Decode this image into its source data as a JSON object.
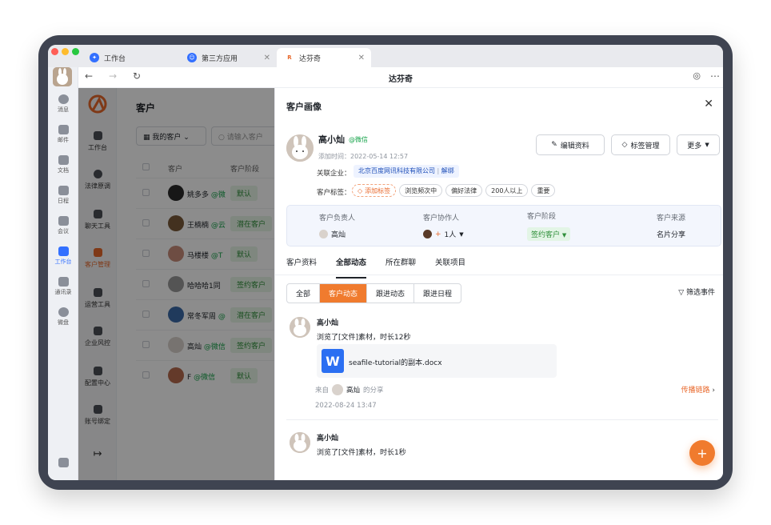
{
  "tabs": [
    {
      "label": "工作台",
      "color": "#3370ff"
    },
    {
      "label": "第三方应用",
      "color": "#3370ff"
    },
    {
      "label": "达芬奇",
      "color": "#e8682b"
    }
  ],
  "navbar": {
    "title": "达芬奇"
  },
  "rail": {
    "items": [
      "消息",
      "邮件",
      "文档",
      "日程",
      "会议",
      "工作台",
      "通讯录",
      "微盘"
    ]
  },
  "appnav": {
    "items": [
      "工作台",
      "法律原调",
      "聊天工具",
      "客户管理",
      "运营工具",
      "企业风控",
      "配置中心",
      "账号绑定"
    ]
  },
  "list": {
    "title": "客户",
    "filter": "我的客户",
    "search_placeholder": "请输入客户",
    "col_customer": "客户",
    "col_stage": "客户阶段",
    "rows": [
      {
        "name": "姚多多",
        "wx": "@微",
        "stage": "默认",
        "color": "#2b2b2b"
      },
      {
        "name": "王楠楠",
        "wx": "@云",
        "stage": "潜在客户",
        "color": "#7a5a3a"
      },
      {
        "name": "马楼楼",
        "wx": "@T",
        "stage": "默认",
        "color": "#c98c7a"
      },
      {
        "name": "哈哈哈1同",
        "wx": "",
        "stage": "签约客户",
        "color": "#9a9a9a"
      },
      {
        "name": "常冬军周",
        "wx": "@",
        "stage": "潜在客户",
        "color": "#3b6aa8"
      },
      {
        "name": "高灿",
        "wx": "@微信",
        "stage": "签约客户",
        "color": "#d9d2cc"
      },
      {
        "name": "F",
        "wx": "@微信",
        "stage": "默认",
        "color": "#b76a4d"
      }
    ]
  },
  "drawer": {
    "title": "客户画像",
    "name": "高小灿",
    "wx_tag": "@微信",
    "added_time": "添加时间：2022-05-14 12:57",
    "edit_button": "编辑资料",
    "tag_manage_button": "标签管理",
    "more_button": "更多",
    "company_label": "关联企业：",
    "company_name": "北京百度网讯科技有限公司",
    "unbind": "解绑",
    "tags_label": "客户标签：",
    "add_tag": "添加标签",
    "tags": [
      "浏览频次中",
      "偏好法律",
      "200人以上",
      "重要"
    ],
    "info": {
      "owner_label": "客户负责人",
      "owner_value": "高灿",
      "collab_label": "客户协作人",
      "collab_value": "1人",
      "stage_label": "客户阶段",
      "stage_value": "签约客户",
      "source_label": "客户来源",
      "source_value": "名片分享"
    },
    "sub_tabs": [
      "客户资料",
      "全部动态",
      "所在群聊",
      "关联项目"
    ],
    "segments": [
      "全部",
      "客户动态",
      "跟进动态",
      "跟进日程"
    ],
    "filter_events": "筛选事件",
    "events": [
      {
        "name": "高小灿",
        "text": "浏览了[文件]素材，时长12秒",
        "file_name": "seafile-tutorial的副本.docx",
        "from_prefix": "来自",
        "from_who": "高灿",
        "from_suffix": "的分享",
        "spread": "传播链路",
        "date": "2022-08-24 13:47"
      },
      {
        "name": "高小灿",
        "text": "浏览了[文件]素材，时长1秒"
      }
    ],
    "fab": "+"
  }
}
